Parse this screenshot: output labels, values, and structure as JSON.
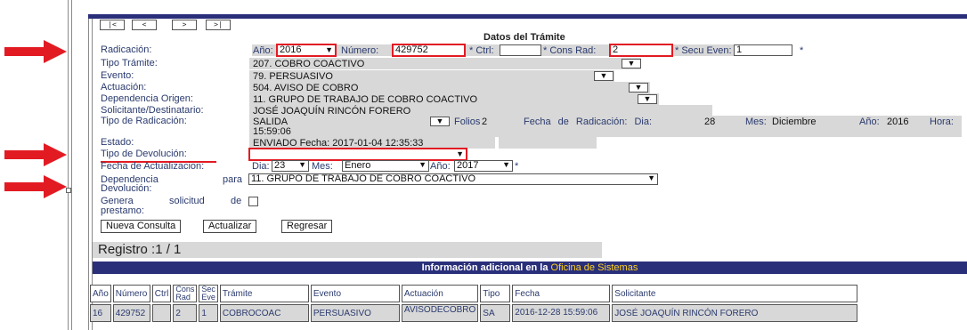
{
  "nav": {
    "first": "|<",
    "prev": "<",
    "next": ">",
    "last": ">|"
  },
  "form": {
    "title": "Datos del Trámite",
    "radicacion": {
      "label": "Radicación:",
      "ano_label": "Año:",
      "ano_value": "2016",
      "numero_label": "Número:",
      "numero_value": "429752",
      "ctrl_label": "* Ctrl:",
      "ctrl_value": "",
      "cons_rad_label": "* Cons Rad:",
      "cons_rad_value": "2",
      "secu_even_label": "* Secu Even:",
      "secu_even_value": "1",
      "required_mark": "*"
    },
    "tipo_tramite": {
      "label": "Tipo Trámite:",
      "value": "207. COBRO COACTIVO"
    },
    "evento": {
      "label": "Evento:",
      "value": "79. PERSUASIVO"
    },
    "actuacion": {
      "label": "Actuación:",
      "value": "504. AVISO DE COBRO"
    },
    "dependencia_origen": {
      "label": "Dependencia Origen:",
      "value": "11. GRUPO DE TRABAJO DE COBRO COACTIVO"
    },
    "solicitante": {
      "label": "Solicitante/Destinatario:",
      "value": "JOSÉ JOAQUÍN RINCÓN FORERO"
    },
    "tipo_radicacion": {
      "label": "Tipo de Radicación:",
      "value": "SALIDA",
      "folios_label": "Folios",
      "folios_value": "2",
      "fecha_label": "Fecha de Radicación: Dia:",
      "dia_value": "28",
      "mes_label": "Mes:",
      "mes_value": "Diciembre",
      "ano_label": "Año:",
      "ano_value": "2016",
      "hora_label": "Hora:",
      "hora_value": "15:59:06"
    },
    "estado": {
      "label": "Estado:",
      "value": "ENVIADO  Fecha: 2017-01-04 12:35:33"
    },
    "tipo_devolucion": {
      "label": "Tipo de Devolución:",
      "value": ""
    },
    "fecha_actualizacion": {
      "label": "Fecha de Actualizacion:",
      "dia_label": "Dia:",
      "dia_value": "23",
      "mes_label": "Mes:",
      "mes_value": "Enero",
      "ano_label": "Año:",
      "ano_value": "2017",
      "required_mark": "*"
    },
    "dependencia_devolucion": {
      "label_line1": "Dependencia",
      "label_para": "para",
      "label_line2": "Devolución:",
      "value": "11. GRUPO DE TRABAJO DE COBRO COACTIVO"
    },
    "genera_prestamo": {
      "label_line1": "Genera",
      "label_solicitud": "solicitud",
      "label_de": "de",
      "label_line2": "prestamo:"
    }
  },
  "buttons": {
    "nueva_consulta": "Nueva Consulta",
    "actualizar": "Actualizar",
    "regresar": "Regresar"
  },
  "registro": "Registro :1 / 1",
  "info": {
    "prefix": "Información adicional en la ",
    "highlight": "Oficina de Sistemas"
  },
  "table": {
    "headers": [
      "Año",
      "Número",
      "Ctrl",
      "Cons Rad",
      "Sec Eve",
      "Trámite",
      "Evento",
      "Actuación",
      "Tipo",
      "Fecha",
      "Solicitante"
    ],
    "row": [
      "16",
      "429752",
      "",
      "2",
      "1",
      "COBROCOAC",
      "PERSUASIVO",
      "AVISODECOBRO",
      "SA",
      "2016-12-28 15:59:06",
      "JOSÉ JOAQUÍN RINCÓN FORERO"
    ]
  },
  "colors": {
    "accent": "#2a2f7a",
    "highlight_red": "#e21b23",
    "highlight_yellow": "#ffd21f"
  }
}
